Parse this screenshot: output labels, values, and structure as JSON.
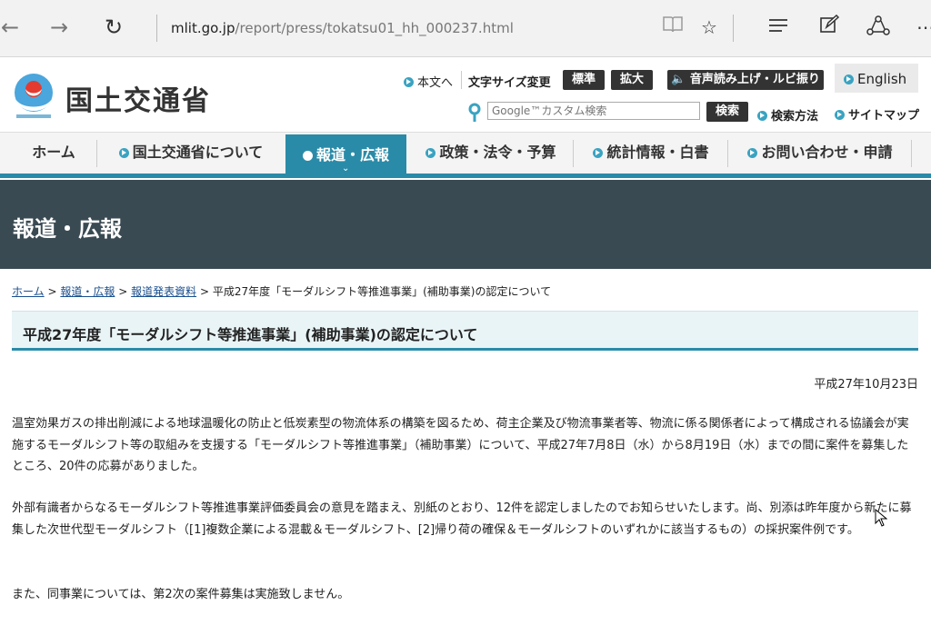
{
  "browser": {
    "url_host": "mlit.go.jp",
    "url_path": "/report/press/tokatsu01_hh_000237.html"
  },
  "header": {
    "logo_text": "国土交通省",
    "skip_link": "本文へ",
    "font_size_label": "文字サイズ変更",
    "font_standard": "標準",
    "font_large": "拡大",
    "speech_button": "音声読み上げ・ルビ振り",
    "english": "English",
    "search_placeholder": "Google™カスタム検索",
    "search_button": "検索",
    "search_method": "検索方法",
    "sitemap": "サイトマップ"
  },
  "nav": {
    "items": [
      "ホーム",
      "国土交通省について",
      "報道・広報",
      "政策・法令・予算",
      "統計情報・白書",
      "お問い合わせ・申請"
    ],
    "active_index": 2
  },
  "page": {
    "section_title": "報道・広報",
    "breadcrumb": [
      "ホーム",
      "報道・広報",
      "報道発表資料",
      "平成27年度「モーダルシフト等推進事業」(補助事業)の認定について"
    ],
    "title": "平成27年度「モーダルシフト等推進事業」(補助事業)の認定について",
    "date": "平成27年10月23日",
    "paragraphs": [
      "温室効果ガスの排出削減による地球温暖化の防止と低炭素型の物流体系の構築を図るため、荷主企業及び物流事業者等、物流に係る関係者によって構成される協議会が実施するモーダルシフト等の取組みを支援する「モーダルシフト等推進事業」（補助事業）について、平成27年7月8日（水）から8月19日（水）までの間に案件を募集したところ、20件の応募がありました。",
      "外部有識者からなるモーダルシフト等推進事業評価委員会の意見を踏まえ、別紙のとおり、12件を認定しましたのでお知らせいたします。尚、別添は昨年度から新たに募集した次世代型モーダルシフト（[1]複数企業による混載＆モーダルシフト、[2]帰り荷の確保＆モーダルシフトのいずれかに該当するもの）の採択案件例です。",
      "また、同事業については、第2次の案件募集は実施致しません。"
    ]
  },
  "colors": {
    "accent": "#2a8ba8",
    "band": "#3a4a53",
    "link": "#1a4f8e"
  }
}
